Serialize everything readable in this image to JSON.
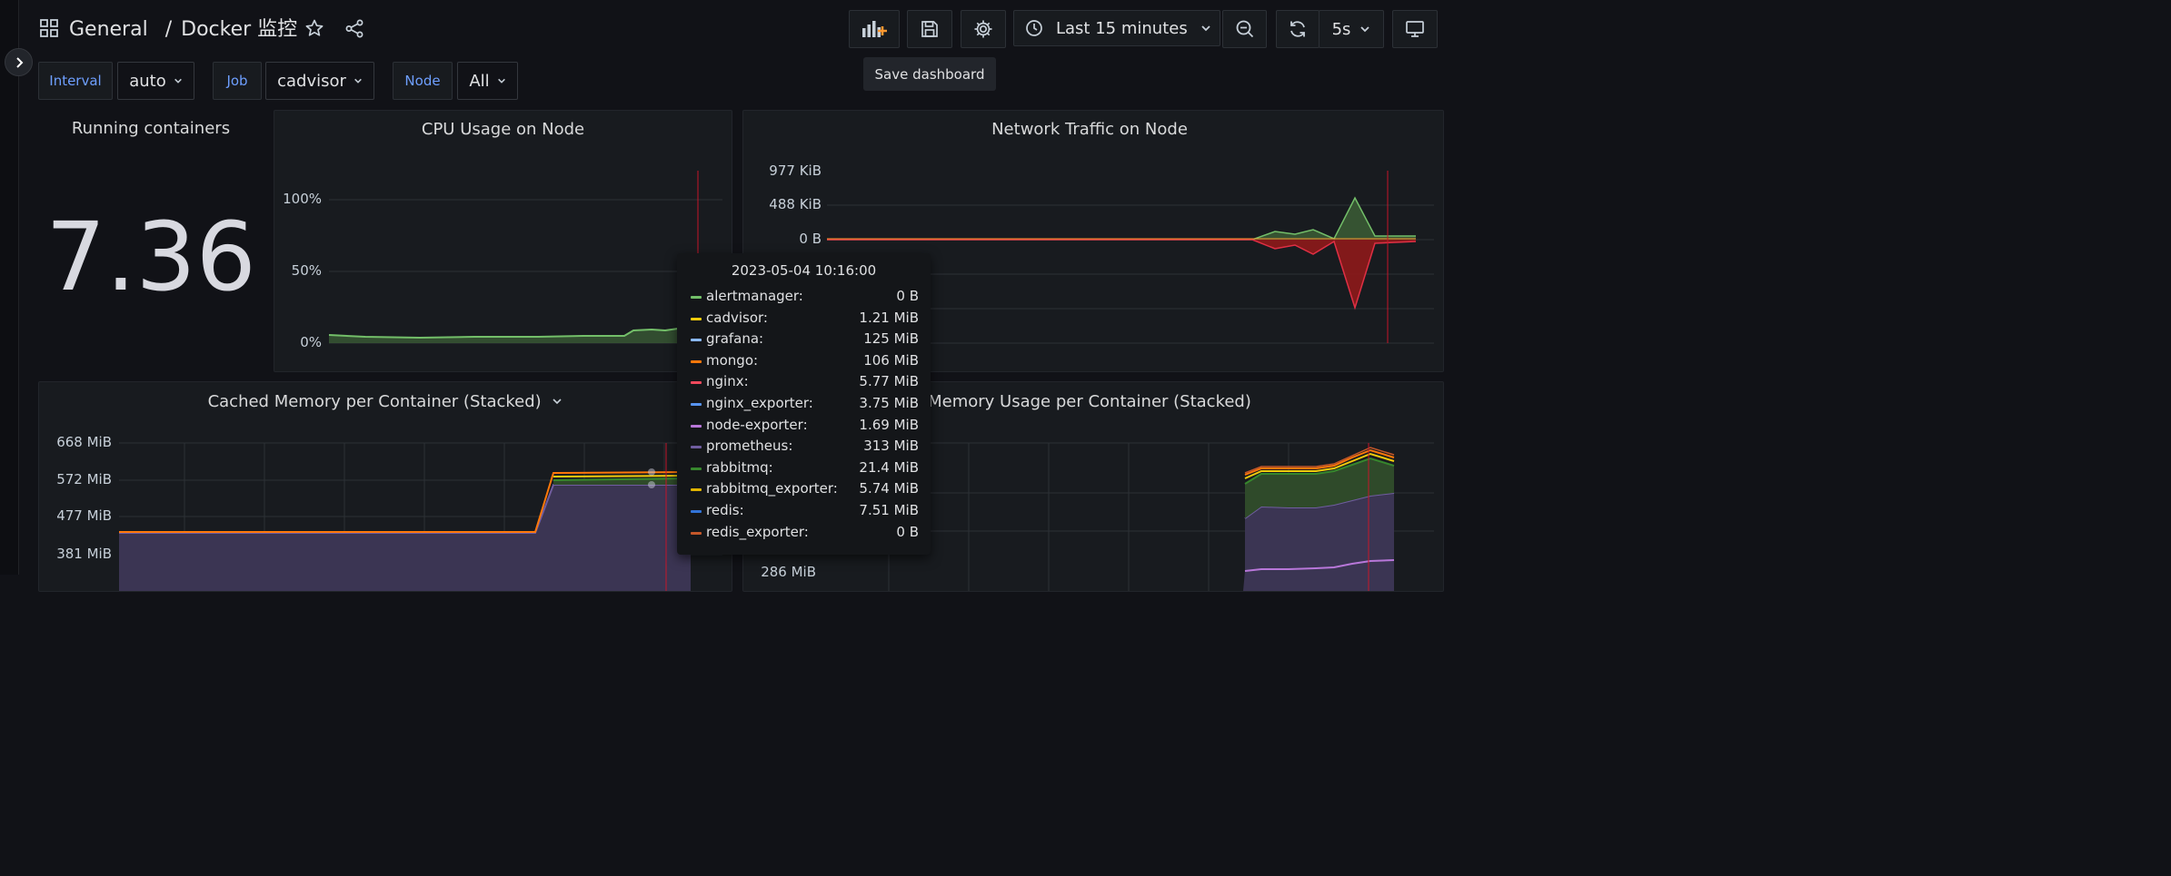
{
  "header": {
    "breadcrumb_folder": "General",
    "breadcrumb_sep": "/",
    "dashboard_title": "Docker 监控",
    "time_range": "Last 15 minutes",
    "refresh_interval": "5s",
    "save_tooltip": "Save dashboard"
  },
  "variables": {
    "interval": {
      "label": "Interval",
      "value": "auto"
    },
    "job": {
      "label": "Job",
      "value": "cadvisor"
    },
    "node": {
      "label": "Node",
      "value": "All"
    }
  },
  "panels": {
    "running": {
      "title": "Running containers",
      "value": "7.36"
    },
    "cpu": {
      "title": "CPU Usage on Node",
      "yticks": [
        "100%",
        "50%",
        "0%"
      ]
    },
    "network": {
      "title": "Network Traffic on Node",
      "yticks": [
        "977 KiB",
        "488 KiB",
        "0 B"
      ]
    },
    "cached": {
      "title": "Cached Memory per Container (Stacked)",
      "yticks": [
        "668 MiB",
        "572 MiB",
        "477 MiB",
        "381 MiB"
      ]
    },
    "memory": {
      "title": "Memory Usage per Container (Stacked)",
      "yticks": [
        "286 MiB"
      ]
    }
  },
  "tooltip": {
    "date": "2023-05-04 10:16:00",
    "rows": [
      {
        "name": "alertmanager:",
        "value": "0 B",
        "color": "#73bf69"
      },
      {
        "name": "cadvisor:",
        "value": "1.21 MiB",
        "color": "#f2cc0c"
      },
      {
        "name": "grafana:",
        "value": "125 MiB",
        "color": "#8ab8ff"
      },
      {
        "name": "mongo:",
        "value": "106 MiB",
        "color": "#ff780a"
      },
      {
        "name": "nginx:",
        "value": "5.77 MiB",
        "color": "#f2495c"
      },
      {
        "name": "nginx_exporter:",
        "value": "3.75 MiB",
        "color": "#5794f2"
      },
      {
        "name": "node-exporter:",
        "value": "1.69 MiB",
        "color": "#b877d9"
      },
      {
        "name": "prometheus:",
        "value": "313 MiB",
        "color": "#705da0"
      },
      {
        "name": "rabbitmq:",
        "value": "21.4 MiB",
        "color": "#37872d"
      },
      {
        "name": "rabbitmq_exporter:",
        "value": "5.74 MiB",
        "color": "#e0b400"
      },
      {
        "name": "redis:",
        "value": "7.51 MiB",
        "color": "#3274d9"
      },
      {
        "name": "redis_exporter:",
        "value": "0 B",
        "color": "#c4572a"
      }
    ]
  }
}
